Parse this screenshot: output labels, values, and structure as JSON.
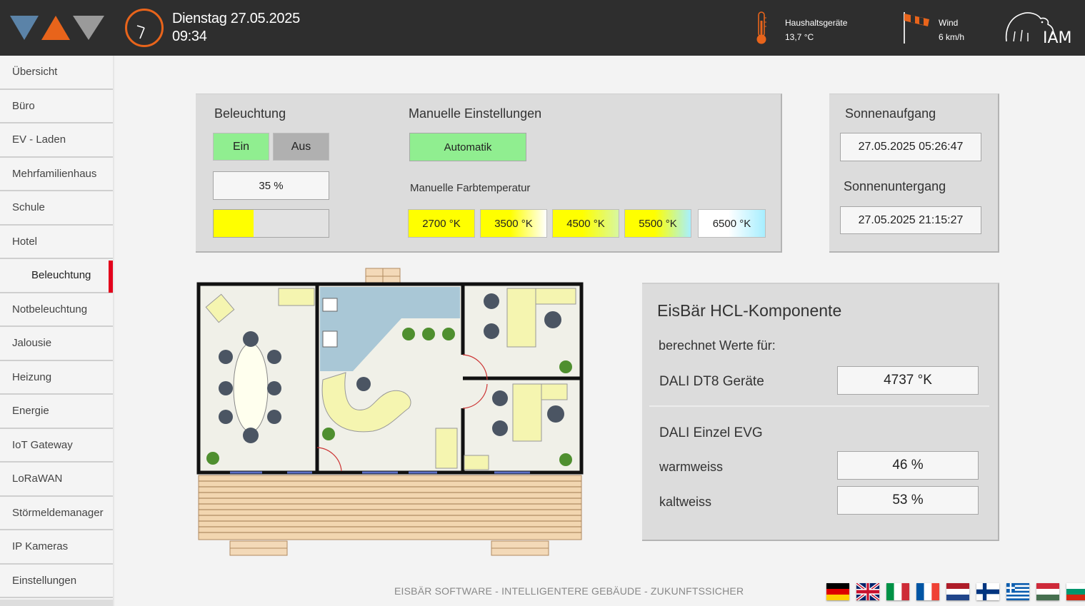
{
  "header": {
    "day_date": "Dienstag 27.05.2025",
    "time": "09:34",
    "sensor_label": "Haushaltsgeräte",
    "sensor_value": "13,7 °C",
    "wind_label": "Wind",
    "wind_value": "6 km/h",
    "logo_icon": "eisbaer-triangle-logo",
    "clock_icon": "clock-icon",
    "thermometer_icon": "thermometer-icon",
    "windsock_icon": "windsock-icon",
    "bear_logo_text": "IAM"
  },
  "sidebar": {
    "items": [
      {
        "label": "Übersicht"
      },
      {
        "label": "Büro"
      },
      {
        "label": "EV - Laden"
      },
      {
        "label": "Mehrfamilienhaus"
      },
      {
        "label": "Schule"
      },
      {
        "label": "Hotel"
      },
      {
        "label": "Beleuchtung",
        "sub": true,
        "active": true
      },
      {
        "label": "Notbeleuchtung"
      },
      {
        "label": "Jalousie"
      },
      {
        "label": "Heizung"
      },
      {
        "label": "Energie"
      },
      {
        "label": "IoT Gateway"
      },
      {
        "label": "LoRaWAN"
      },
      {
        "label": "Störmeldemanager"
      },
      {
        "label": "IP Kameras"
      },
      {
        "label": "Einstellungen"
      }
    ]
  },
  "lighting": {
    "title": "Beleuchtung",
    "on_label": "Ein",
    "off_label": "Aus",
    "level_text": "35 %",
    "level_fraction": 0.35,
    "on_color": "#90ee90",
    "off_color": "#b0b0b0",
    "bar_color": "#ffff00"
  },
  "manual": {
    "title": "Manuelle Einstellungen",
    "auto_label": "Automatik",
    "color_temp_title": "Manuelle Farbtemperatur",
    "temps": [
      {
        "label": "2700 °K",
        "colors": [
          "#ffff00",
          "#ffff00"
        ]
      },
      {
        "label": "3500 °K",
        "colors": [
          "#ffff00",
          "#ffffff"
        ]
      },
      {
        "label": "4500 °K",
        "colors": [
          "#ffff00",
          "#d8f7a0"
        ]
      },
      {
        "label": "5500 °K",
        "colors": [
          "#ffff00",
          "#a7f0ff"
        ]
      },
      {
        "label": "6500 °K",
        "colors": [
          "#ffffff",
          "#a7eeff"
        ]
      }
    ]
  },
  "sun": {
    "sunrise_title": "Sonnenaufgang",
    "sunrise_value": "27.05.2025 05:26:47",
    "sunset_title": "Sonnenuntergang",
    "sunset_value": "27.05.2025 21:15:27"
  },
  "hcl": {
    "title": "EisBär HCL-Komponente",
    "subtitle": "berechnet Werte für:",
    "dt8_label": "DALI DT8 Geräte",
    "dt8_value": "4737 °K",
    "evg_title": "DALI Einzel EVG",
    "warm_label": "warmweiss",
    "warm_value": "46 %",
    "cold_label": "kaltweiss",
    "cold_value": "53 %"
  },
  "footer": {
    "tagline": "EISBÄR SOFTWARE - INTELLIGENTERE GEBÄUDE - ZUKUNFTSSICHER",
    "languages": [
      "de-flag-icon",
      "uk-flag-icon",
      "it-flag-icon",
      "fr-flag-icon",
      "nl-flag-icon",
      "fi-flag-icon",
      "gr-flag-icon",
      "hu-flag-icon",
      "bg-flag-icon"
    ]
  }
}
